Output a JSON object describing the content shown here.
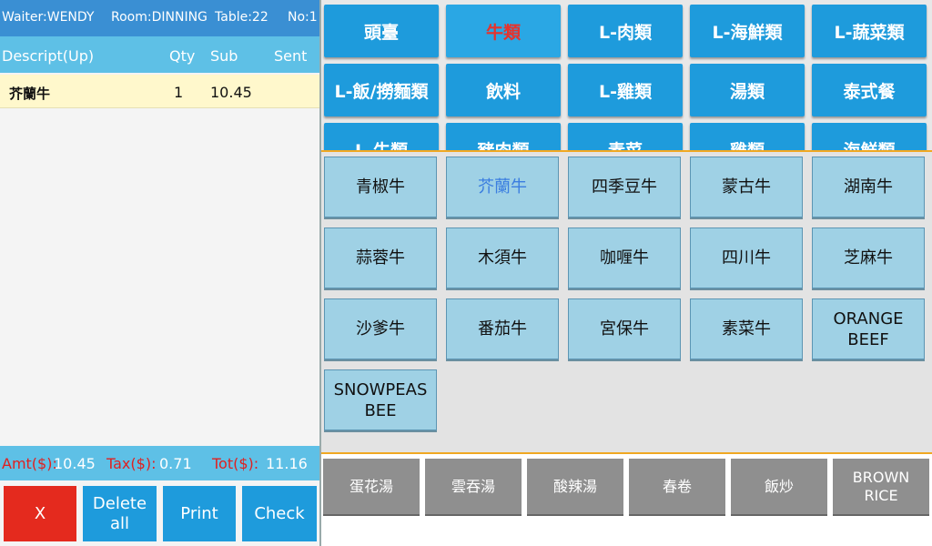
{
  "header": {
    "waiter": "Waiter:WENDY",
    "room": "Room:DINNING",
    "table": "Table:22",
    "no": "No:1"
  },
  "columns": {
    "desc": "Descript(Up)",
    "qty": "Qty",
    "sub": "Sub",
    "sent": "Sent"
  },
  "order_items": [
    {
      "name": "芥蘭牛",
      "qty": "1",
      "sub": "10.45",
      "sent": ""
    }
  ],
  "totals": {
    "amt_label": "Amt($):",
    "amt": "10.45",
    "tax_label": "Tax($):",
    "tax": "0.71",
    "tot_label": "Tot($):",
    "tot": "11.16"
  },
  "actions": {
    "x": "X",
    "delete_all": "Delete all",
    "print": "Print",
    "check": "Check"
  },
  "categories": [
    "頭臺",
    "牛類",
    "L-肉類",
    "L-海鮮類",
    "L-蔬菜類",
    "L-飯/撈麵類",
    "飲料",
    "L-雞類",
    "湯類",
    "泰式餐",
    "L-牛類",
    "豬肉類",
    "素菜",
    "雞類",
    "海鮮類"
  ],
  "active_category": "牛類",
  "items": [
    "青椒牛",
    "芥蘭牛",
    "四季豆牛",
    "蒙古牛",
    "湖南牛",
    "蒜蓉牛",
    "木須牛",
    "咖喱牛",
    "四川牛",
    "芝麻牛",
    "沙爹牛",
    "番茄牛",
    "宮保牛",
    "素菜牛",
    "ORANGE BEEF",
    "SNOWPEAS BEE"
  ],
  "selected_item": "芥蘭牛",
  "sides": [
    "蛋花湯",
    "雲吞湯",
    "酸辣湯",
    "春卷",
    "飯炒",
    "BROWN RICE"
  ],
  "colors": {
    "header_bg": "#3a8fd3",
    "list_header_bg": "#5ec0e6",
    "category_bg": "#1e9bdc",
    "item_bg": "#9fd1e5",
    "side_bg": "#8f8f8f",
    "x_button": "#e42a1e",
    "action_button": "#1e9bdc",
    "selected_row": "#fff8cc",
    "separator": "#f0a822"
  }
}
